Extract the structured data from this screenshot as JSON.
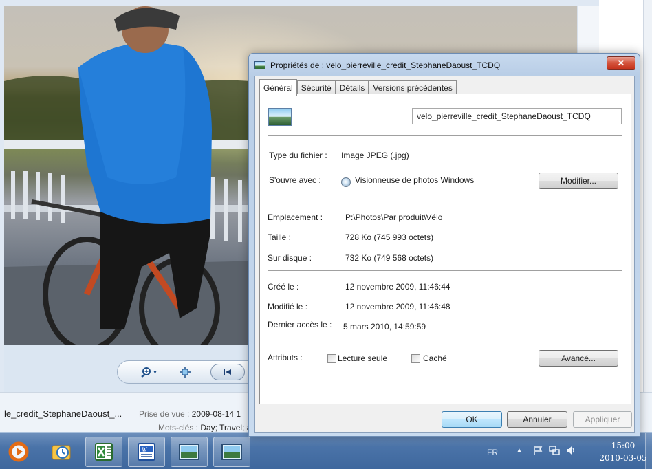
{
  "viewer": {
    "photo_alt": "cyclist on bridge at sunset",
    "controls": {
      "zoom_icon": "zoom-icon",
      "zoom_arrow": "▾",
      "fit_icon": "fit-icon",
      "prev_icon": "previous-icon"
    },
    "info": {
      "filename": "le_credit_StephaneDaoust_...",
      "date_label": "Prise de vue : ",
      "date_value": "2009-08-14 1",
      "keywords_label": "Mots-clés : ",
      "keywords_value": "Day; Travel; a"
    }
  },
  "dialog": {
    "title": "Propriétés de : velo_pierreville_credit_StephaneDaoust_TCDQ",
    "close_label": "✕",
    "tabs": [
      {
        "label": "Général"
      },
      {
        "label": "Sécurité"
      },
      {
        "label": "Détails"
      },
      {
        "label": "Versions précédentes"
      }
    ],
    "filename_value": "velo_pierreville_credit_StephaneDaoust_TCDQ",
    "type_label": "Type du fichier :",
    "type_value": "Image JPEG (.jpg)",
    "opens_label": "S'ouvre avec :",
    "opens_value": "Visionneuse de photos Windows",
    "modify_button": "Modifier...",
    "location_label": "Emplacement :",
    "location_value": "P:\\Photos\\Par produit\\Vélo",
    "size_label": "Taille :",
    "size_value": "728 Ko (745 993 octets)",
    "disk_label": "Sur disque :",
    "disk_value": "732 Ko (749 568 octets)",
    "created_label": "Créé le :",
    "created_value": "12 novembre 2009, 11:46:44",
    "modified_label": "Modifié le :",
    "modified_value": "12 novembre 2009, 11:46:48",
    "accessed_label": "Dernier accès le :",
    "accessed_value": "5 mars 2010, 14:59:59",
    "attributes_label": "Attributs :",
    "readonly_label": "Lecture seule",
    "readonly_checked": false,
    "hidden_label": "Caché",
    "hidden_checked": false,
    "advanced_button": "Avancé...",
    "ok_button": "OK",
    "cancel_button": "Annuler",
    "apply_button": "Appliquer"
  },
  "taskbar": {
    "apps": [
      {
        "name": "media-player-icon"
      },
      {
        "name": "outlook-icon"
      },
      {
        "name": "excel-icon"
      },
      {
        "name": "word-icon"
      },
      {
        "name": "photo-viewer-icon"
      },
      {
        "name": "photo-viewer-icon-2"
      }
    ],
    "language": "FR",
    "tray_arrow": "▲",
    "time": "15:00",
    "date": "2010-03-05"
  },
  "colors": {
    "taskbar": "#4a73a8",
    "close_button": "#c3301a",
    "default_button_border": "#3c7fb1"
  }
}
